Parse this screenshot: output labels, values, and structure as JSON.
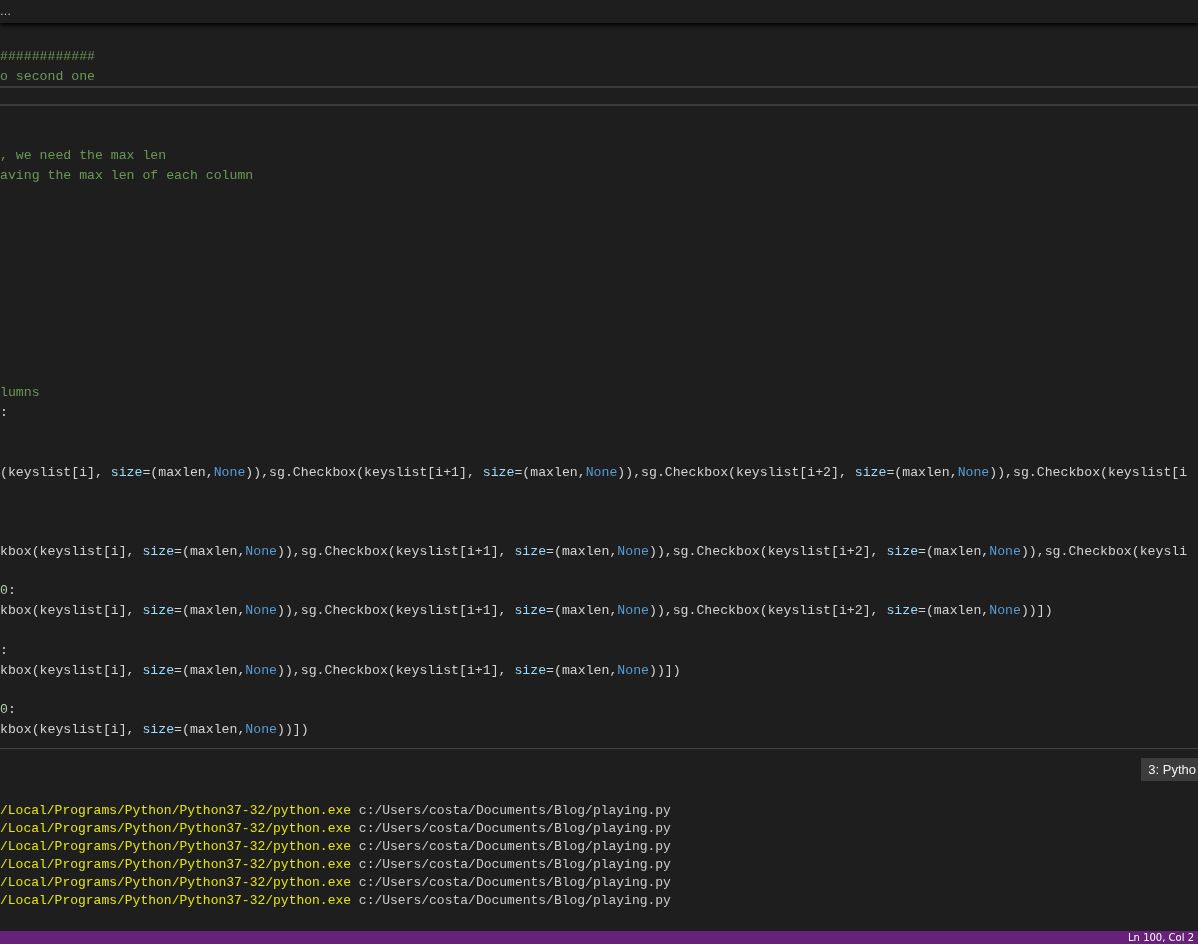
{
  "breadcrumb": "…",
  "editor": {
    "lines": [
      {
        "highlighted": false
      },
      {
        "highlighted": false,
        "tokens": [
          {
            "kind": "comment",
            "text": "############"
          }
        ]
      },
      {
        "highlighted": false,
        "tokens": [
          {
            "kind": "comment",
            "text": "o second one"
          }
        ]
      },
      {
        "highlighted": true
      },
      {
        "highlighted": false
      },
      {
        "highlighted": false
      },
      {
        "highlighted": false,
        "tokens": [
          {
            "kind": "comment",
            "text": ", we need the max len"
          }
        ]
      },
      {
        "highlighted": false,
        "tokens": [
          {
            "kind": "comment",
            "text": "aving the max len of each column"
          }
        ]
      },
      {
        "highlighted": false
      },
      {
        "highlighted": false
      },
      {
        "highlighted": false
      },
      {
        "highlighted": false
      },
      {
        "highlighted": false
      },
      {
        "highlighted": false
      },
      {
        "highlighted": false
      },
      {
        "highlighted": false
      },
      {
        "highlighted": false
      },
      {
        "highlighted": false
      },
      {
        "highlighted": false,
        "tokens": [
          {
            "kind": "comment",
            "text": "lumns"
          }
        ]
      },
      {
        "highlighted": false,
        "tokens": [
          {
            "kind": "plain",
            "text": ":"
          }
        ]
      },
      {
        "highlighted": false
      },
      {
        "highlighted": false
      },
      {
        "highlighted": false,
        "tokens": [
          {
            "kind": "plain",
            "text": "(keyslist[i], "
          },
          {
            "kind": "param",
            "text": "size"
          },
          {
            "kind": "plain",
            "text": "=(maxlen,"
          },
          {
            "kind": "const",
            "text": "None"
          },
          {
            "kind": "plain",
            "text": ")),sg.Checkbox(keyslist[i+1], "
          },
          {
            "kind": "param",
            "text": "size"
          },
          {
            "kind": "plain",
            "text": "=(maxlen,"
          },
          {
            "kind": "const",
            "text": "None"
          },
          {
            "kind": "plain",
            "text": ")),sg.Checkbox(keyslist[i+2], "
          },
          {
            "kind": "param",
            "text": "size"
          },
          {
            "kind": "plain",
            "text": "=(maxlen,"
          },
          {
            "kind": "const",
            "text": "None"
          },
          {
            "kind": "plain",
            "text": ")),sg.Checkbox(keyslist[i"
          }
        ]
      },
      {
        "highlighted": false
      },
      {
        "highlighted": false
      },
      {
        "highlighted": false
      },
      {
        "highlighted": false,
        "tokens": [
          {
            "kind": "plain",
            "text": "kbox(keyslist[i], "
          },
          {
            "kind": "param",
            "text": "size"
          },
          {
            "kind": "plain",
            "text": "=(maxlen,"
          },
          {
            "kind": "const",
            "text": "None"
          },
          {
            "kind": "plain",
            "text": ")),sg.Checkbox(keyslist[i+1], "
          },
          {
            "kind": "param",
            "text": "size"
          },
          {
            "kind": "plain",
            "text": "=(maxlen,"
          },
          {
            "kind": "const",
            "text": "None"
          },
          {
            "kind": "plain",
            "text": ")),sg.Checkbox(keyslist[i+2], "
          },
          {
            "kind": "param",
            "text": "size"
          },
          {
            "kind": "plain",
            "text": "=(maxlen,"
          },
          {
            "kind": "const",
            "text": "None"
          },
          {
            "kind": "plain",
            "text": ")),sg.Checkbox(keysli"
          }
        ]
      },
      {
        "highlighted": false
      },
      {
        "highlighted": false,
        "tokens": [
          {
            "kind": "number",
            "text": "0"
          },
          {
            "kind": "plain",
            "text": ":"
          }
        ]
      },
      {
        "highlighted": false,
        "tokens": [
          {
            "kind": "plain",
            "text": "kbox(keyslist[i], "
          },
          {
            "kind": "param",
            "text": "size"
          },
          {
            "kind": "plain",
            "text": "=(maxlen,"
          },
          {
            "kind": "const",
            "text": "None"
          },
          {
            "kind": "plain",
            "text": ")),sg.Checkbox(keyslist[i+1], "
          },
          {
            "kind": "param",
            "text": "size"
          },
          {
            "kind": "plain",
            "text": "=(maxlen,"
          },
          {
            "kind": "const",
            "text": "None"
          },
          {
            "kind": "plain",
            "text": ")),sg.Checkbox(keyslist[i+2], "
          },
          {
            "kind": "param",
            "text": "size"
          },
          {
            "kind": "plain",
            "text": "=(maxlen,"
          },
          {
            "kind": "const",
            "text": "None"
          },
          {
            "kind": "plain",
            "text": "))])"
          }
        ]
      },
      {
        "highlighted": false
      },
      {
        "highlighted": false,
        "tokens": [
          {
            "kind": "plain",
            "text": ":"
          }
        ]
      },
      {
        "highlighted": false,
        "tokens": [
          {
            "kind": "plain",
            "text": "kbox(keyslist[i], "
          },
          {
            "kind": "param",
            "text": "size"
          },
          {
            "kind": "plain",
            "text": "=(maxlen,"
          },
          {
            "kind": "const",
            "text": "None"
          },
          {
            "kind": "plain",
            "text": ")),sg.Checkbox(keyslist[i+1], "
          },
          {
            "kind": "param",
            "text": "size"
          },
          {
            "kind": "plain",
            "text": "=(maxlen,"
          },
          {
            "kind": "const",
            "text": "None"
          },
          {
            "kind": "plain",
            "text": "))])"
          }
        ]
      },
      {
        "highlighted": false
      },
      {
        "highlighted": false,
        "tokens": [
          {
            "kind": "number",
            "text": "0"
          },
          {
            "kind": "plain",
            "text": ":"
          }
        ]
      },
      {
        "highlighted": false,
        "tokens": [
          {
            "kind": "plain",
            "text": "kbox(keyslist[i], "
          },
          {
            "kind": "param",
            "text": "size"
          },
          {
            "kind": "plain",
            "text": "=(maxlen,"
          },
          {
            "kind": "const",
            "text": "None"
          },
          {
            "kind": "plain",
            "text": "))])"
          }
        ]
      }
    ]
  },
  "panel": {
    "terminal_selector": "3: Pytho",
    "lines": [
      {
        "command": "/Local/Programs/Python/Python37-32/python.exe",
        "argument": "c:/Users/costa/Documents/Blog/playing.py"
      },
      {
        "command": "/Local/Programs/Python/Python37-32/python.exe",
        "argument": "c:/Users/costa/Documents/Blog/playing.py"
      },
      {
        "command": "/Local/Programs/Python/Python37-32/python.exe",
        "argument": "c:/Users/costa/Documents/Blog/playing.py"
      },
      {
        "command": "/Local/Programs/Python/Python37-32/python.exe",
        "argument": "c:/Users/costa/Documents/Blog/playing.py"
      },
      {
        "command": "/Local/Programs/Python/Python37-32/python.exe",
        "argument": "c:/Users/costa/Documents/Blog/playing.py"
      },
      {
        "command": "/Local/Programs/Python/Python37-32/python.exe",
        "argument": "c:/Users/costa/Documents/Blog/playing.py"
      }
    ]
  },
  "status_bar": {
    "cursor_position": "Ln 100, Col 2"
  }
}
